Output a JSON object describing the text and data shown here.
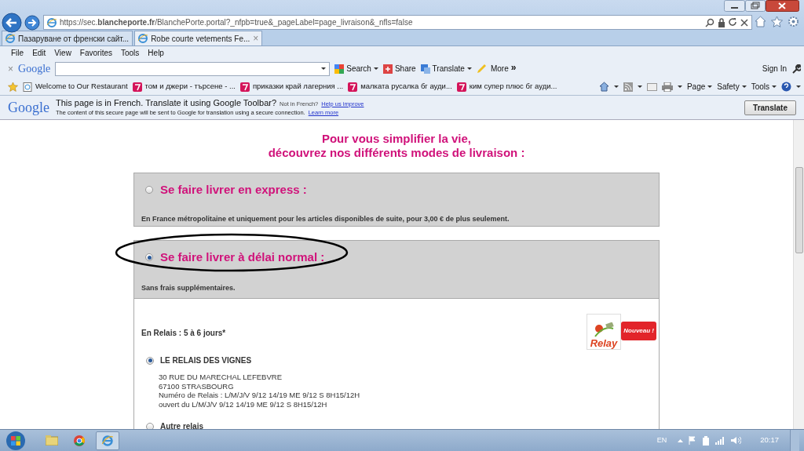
{
  "address_bar": {
    "url": "https://sec.**blancheporte.fr**/BlanchePorte.portal?_nfpb=true&_pageLabel=page_livraison&_nfls=false"
  },
  "tabs": [
    {
      "title": "Пазаруване от френски сайт...",
      "selected": false
    },
    {
      "title": "Robe courte vetements Fe...",
      "selected": true,
      "close": "×"
    }
  ],
  "menu": [
    "File",
    "Edit",
    "View",
    "Favorites",
    "Tools",
    "Help"
  ],
  "google_toolbar": {
    "close": "×",
    "logo": "Google",
    "search": "Search",
    "share": "Share",
    "translate": "Translate",
    "more": "More",
    "more_glyph": "»",
    "sign_in": "Sign In"
  },
  "favorites": [
    "Welcome to Our Restaurant",
    "том и джери - търсене - ...",
    "приказки край лагерния ...",
    "малката русалка бг ауди...",
    "ким супер плюс бг ауди..."
  ],
  "command_bar": [
    "Page",
    "Safety",
    "Tools"
  ],
  "translate_bar": {
    "logo": "Google",
    "message": "This page is in French.  Translate it using Google Toolbar?",
    "not_in": "Not in French?",
    "help_link": "Help us improve",
    "note": "The content of this secure page will be sent to Google for translation using a secure connection.",
    "learn_more": "Learn more",
    "button": "Translate"
  },
  "page": {
    "heading": [
      "Pour vous simplifier la vie,",
      "découvrez nos différents modes de livraison :"
    ],
    "options": [
      {
        "title": "Se faire livrer en express :",
        "description": "En France métropolitaine et uniquement pour les articles disponibles de suite, pour 3,00 € de plus seulement.",
        "selected": false
      },
      {
        "title": "Se faire livrer à délai normal :",
        "description": "Sans frais supplémentaires.",
        "selected": true
      }
    ],
    "relay": {
      "label": "En Relais : 5 à 6 jours*",
      "logo": "Relay",
      "badge": "Nouveau !",
      "choices": [
        {
          "name": "LE RELAIS DES VIGNES",
          "selected": true,
          "lines": [
            "30 RUE DU MARECHAL LEFEBVRE",
            "67100 STRASBOURG",
            "Numéro de Relais : L/M/J/V 9/12 14/19 ME 9/12 S 8H15/12H",
            "ouvert du L/M/J/V 9/12 14/19 ME 9/12 S 8H15/12H"
          ]
        },
        {
          "name": "Autre relais",
          "selected": false
        }
      ]
    }
  },
  "taskbar": {
    "language": "EN",
    "clock": "20:17"
  }
}
